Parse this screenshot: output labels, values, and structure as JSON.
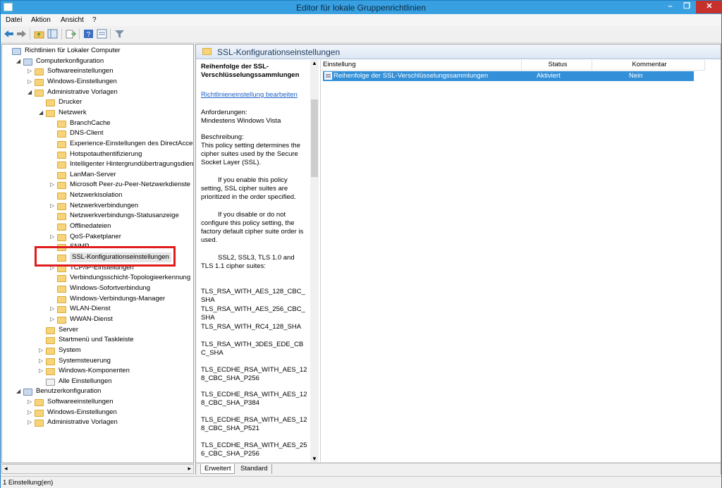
{
  "window": {
    "title": "Editor für lokale Gruppenrichtlinien"
  },
  "menu": [
    "Datei",
    "Aktion",
    "Ansicht",
    "?"
  ],
  "toolbar": [
    "back-icon",
    "forward-icon",
    "up-folder-icon",
    "show-hide-tree-icon",
    "export-icon",
    "help-icon",
    "properties-icon",
    "filter-icon"
  ],
  "tree": {
    "items": [
      {
        "label": "Richtlinien für Lokaler Computer",
        "level": 0,
        "expander": "",
        "icon": "computer"
      },
      {
        "label": "Computerkonfiguration",
        "level": 1,
        "expander": "open",
        "icon": "computer"
      },
      {
        "label": "Softwareeinstellungen",
        "level": 2,
        "expander": "closed",
        "icon": "folder"
      },
      {
        "label": "Windows-Einstellungen",
        "level": 2,
        "expander": "closed",
        "icon": "folder"
      },
      {
        "label": "Administrative Vorlagen",
        "level": 2,
        "expander": "open",
        "icon": "folder"
      },
      {
        "label": "Drucker",
        "level": 3,
        "expander": "",
        "icon": "folder"
      },
      {
        "label": "Netzwerk",
        "level": 3,
        "expander": "open",
        "icon": "folder"
      },
      {
        "label": "BranchCache",
        "level": 4,
        "expander": "",
        "icon": "folder"
      },
      {
        "label": "DNS-Client",
        "level": 4,
        "expander": "",
        "icon": "folder"
      },
      {
        "label": "Experience-Einstellungen des DirectAccess-C",
        "level": 4,
        "expander": "",
        "icon": "folder"
      },
      {
        "label": "Hotspotauthentifizierung",
        "level": 4,
        "expander": "",
        "icon": "folder"
      },
      {
        "label": "Intelligenter Hintergrundübertragungsdienst",
        "level": 4,
        "expander": "",
        "icon": "folder"
      },
      {
        "label": "LanMan-Server",
        "level": 4,
        "expander": "",
        "icon": "folder"
      },
      {
        "label": "Microsoft Peer-zu-Peer-Netzwerkdienste",
        "level": 4,
        "expander": "closed",
        "icon": "folder"
      },
      {
        "label": "Netzwerkisolation",
        "level": 4,
        "expander": "",
        "icon": "folder"
      },
      {
        "label": "Netzwerkverbindungen",
        "level": 4,
        "expander": "closed",
        "icon": "folder"
      },
      {
        "label": "Netzwerkverbindungs-Statusanzeige",
        "level": 4,
        "expander": "",
        "icon": "folder"
      },
      {
        "label": "Offlinedateien",
        "level": 4,
        "expander": "",
        "icon": "folder"
      },
      {
        "label": "QoS-Paketplaner",
        "level": 4,
        "expander": "closed",
        "icon": "folder"
      },
      {
        "label": "SNMP",
        "level": 4,
        "expander": "",
        "icon": "folder"
      },
      {
        "label": "SSL-Konfigurationseinstellungen",
        "level": 4,
        "expander": "",
        "icon": "folder",
        "selected": true
      },
      {
        "label": "TCP/IP-Einstellungen",
        "level": 4,
        "expander": "closed",
        "icon": "folder"
      },
      {
        "label": "Verbindungsschicht-Topologieerkennung",
        "level": 4,
        "expander": "",
        "icon": "folder"
      },
      {
        "label": "Windows-Sofortverbindung",
        "level": 4,
        "expander": "",
        "icon": "folder"
      },
      {
        "label": "Windows-Verbindungs-Manager",
        "level": 4,
        "expander": "",
        "icon": "folder"
      },
      {
        "label": "WLAN-Dienst",
        "level": 4,
        "expander": "closed",
        "icon": "folder"
      },
      {
        "label": "WWAN-Dienst",
        "level": 4,
        "expander": "closed",
        "icon": "folder"
      },
      {
        "label": "Server",
        "level": 3,
        "expander": "",
        "icon": "folder"
      },
      {
        "label": "Startmenü und Taskleiste",
        "level": 3,
        "expander": "",
        "icon": "folder"
      },
      {
        "label": "System",
        "level": 3,
        "expander": "closed",
        "icon": "folder"
      },
      {
        "label": "Systemsteuerung",
        "level": 3,
        "expander": "closed",
        "icon": "folder"
      },
      {
        "label": "Windows-Komponenten",
        "level": 3,
        "expander": "closed",
        "icon": "folder"
      },
      {
        "label": "Alle Einstellungen",
        "level": 3,
        "expander": "",
        "icon": "settings"
      },
      {
        "label": "Benutzerkonfiguration",
        "level": 1,
        "expander": "open",
        "icon": "computer"
      },
      {
        "label": "Softwareeinstellungen",
        "level": 2,
        "expander": "closed",
        "icon": "folder"
      },
      {
        "label": "Windows-Einstellungen",
        "level": 2,
        "expander": "closed",
        "icon": "folder"
      },
      {
        "label": "Administrative Vorlagen",
        "level": 2,
        "expander": "closed",
        "icon": "folder"
      }
    ]
  },
  "right": {
    "header": "SSL-Konfigurationseinstellungen",
    "description": {
      "title": "Reihenfolge der SSL-Verschlüsselungssammlungen",
      "edit_link": "Richtlinieneinstellung bearbeiten",
      "requirements": "Anforderungen:\nMindestens Windows Vista",
      "desc_label": "Beschreibung:",
      "paragraphs": [
        "This policy setting determines the cipher suites used by the Secure Socket Layer (SSL).",
        "If you enable this policy setting, SSL cipher suites are prioritized in the order specified.",
        "If you disable or do not configure this policy setting, the factory default cipher suite order is used.",
        "SSL2, SSL3, TLS 1.0 and TLS 1.1 cipher suites:",
        "TLS_RSA_WITH_AES_128_CBC_SHA",
        "TLS_RSA_WITH_AES_256_CBC_SHA",
        "TLS_RSA_WITH_RC4_128_SHA",
        "TLS_RSA_WITH_3DES_EDE_CBC_SHA",
        "TLS_ECDHE_RSA_WITH_AES_128_CBC_SHA_P256",
        "TLS_ECDHE_RSA_WITH_AES_128_CBC_SHA_P384",
        "TLS_ECDHE_RSA_WITH_AES_128_CBC_SHA_P521",
        "TLS_ECDHE_RSA_WITH_AES_256_CBC_SHA_P256"
      ]
    },
    "columns": [
      "Einstellung",
      "Status",
      "Kommentar"
    ],
    "rows": [
      {
        "setting": "Reihenfolge der SSL-Verschlüsselungssammlungen",
        "status": "Aktiviert",
        "comment": "Nein"
      }
    ],
    "tabs": [
      "Erweitert",
      "Standard"
    ]
  },
  "status": "1 Einstellung(en)"
}
